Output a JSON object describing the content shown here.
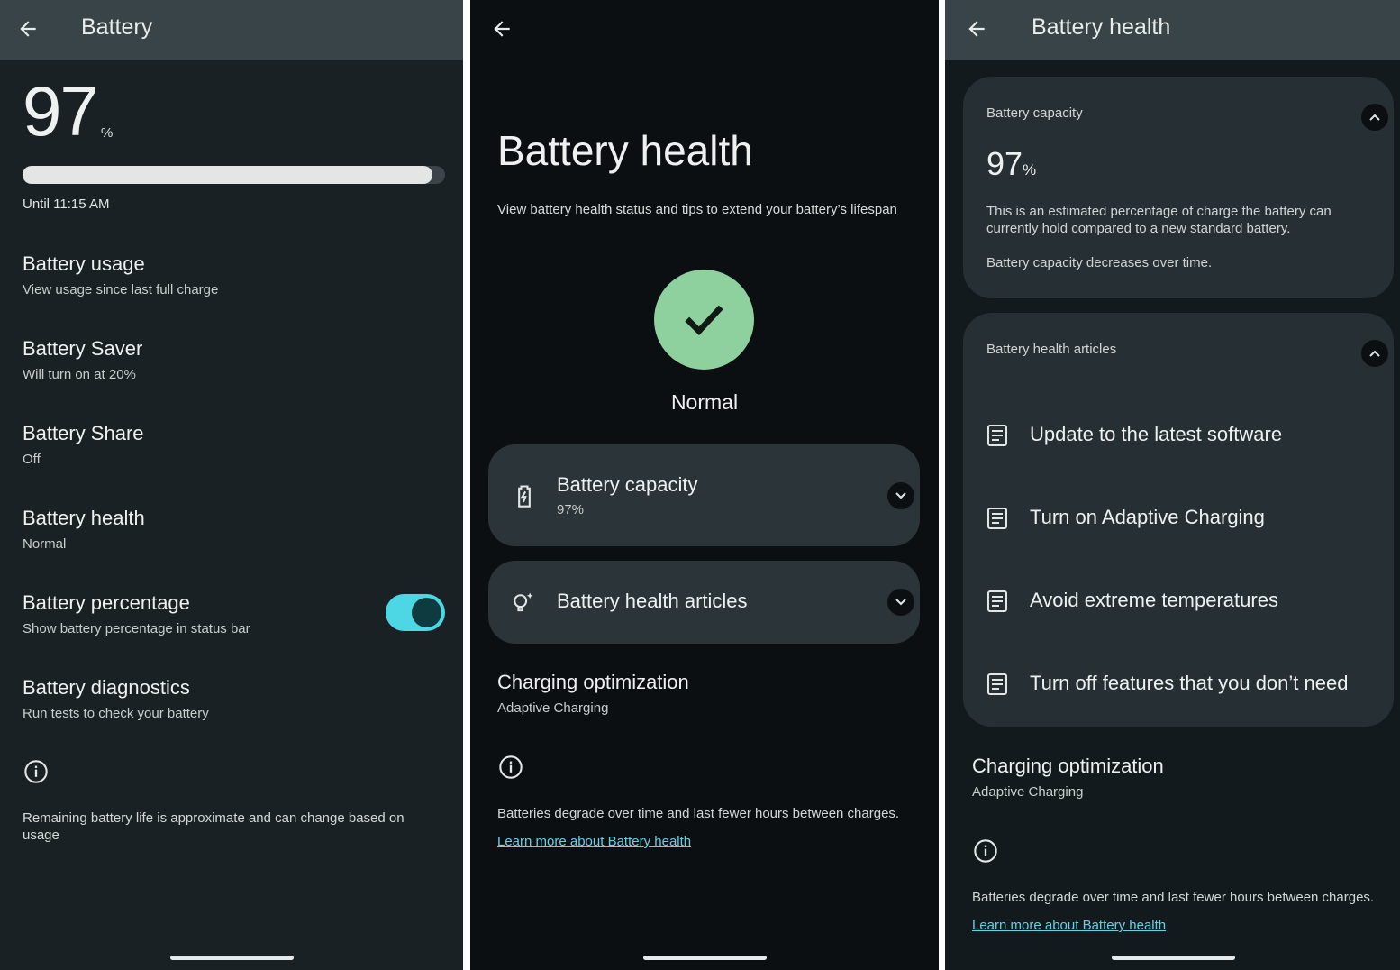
{
  "colors": {
    "accent": "#4dd6e3",
    "status_ok": "#8fd19e",
    "link": "#64d2e6",
    "card": "#2b3438"
  },
  "battery_screen": {
    "title": "Battery",
    "percent": "97",
    "percent_unit": "%",
    "level_fraction": 0.97,
    "until": "Until 11:15 AM",
    "items": [
      {
        "title": "Battery usage",
        "subtitle": "View usage since last full charge"
      },
      {
        "title": "Battery Saver",
        "subtitle": "Will turn on at 20%"
      },
      {
        "title": "Battery Share",
        "subtitle": "Off"
      },
      {
        "title": "Battery health",
        "subtitle": "Normal"
      },
      {
        "title": "Battery percentage",
        "subtitle": "Show battery percentage in status bar",
        "toggle_on": true
      },
      {
        "title": "Battery diagnostics",
        "subtitle": "Run tests to check your battery"
      }
    ],
    "footer_text": "Remaining battery life is approximate and can change based on usage"
  },
  "health_screen": {
    "title": "Battery health",
    "subtitle": "View battery health status and tips to extend your battery’s lifespan",
    "status": "Normal",
    "capacity_card": {
      "title": "Battery capacity",
      "value": "97%"
    },
    "articles_card": {
      "title": "Battery health articles"
    },
    "charging": {
      "title": "Charging optimization",
      "subtitle": "Adaptive Charging"
    },
    "footer_text": "Batteries degrade over time and last fewer hours between charges.",
    "link": "Learn more about Battery health"
  },
  "health_expanded": {
    "title": "Battery health",
    "capacity": {
      "label": "Battery capacity",
      "value": "97",
      "unit": "%",
      "description": "This is an estimated percentage of charge the battery can currently hold compared to a new standard battery.",
      "note": "Battery capacity decreases over time."
    },
    "articles": {
      "label": "Battery health articles",
      "items": [
        "Update to the latest software",
        "Turn on Adaptive Charging",
        "Avoid extreme temperatures",
        "Turn off features that you don’t need"
      ]
    },
    "charging": {
      "title": "Charging optimization",
      "subtitle": "Adaptive Charging"
    },
    "footer_text": "Batteries degrade over time and last fewer hours between charges.",
    "link": "Learn more about Battery health"
  }
}
